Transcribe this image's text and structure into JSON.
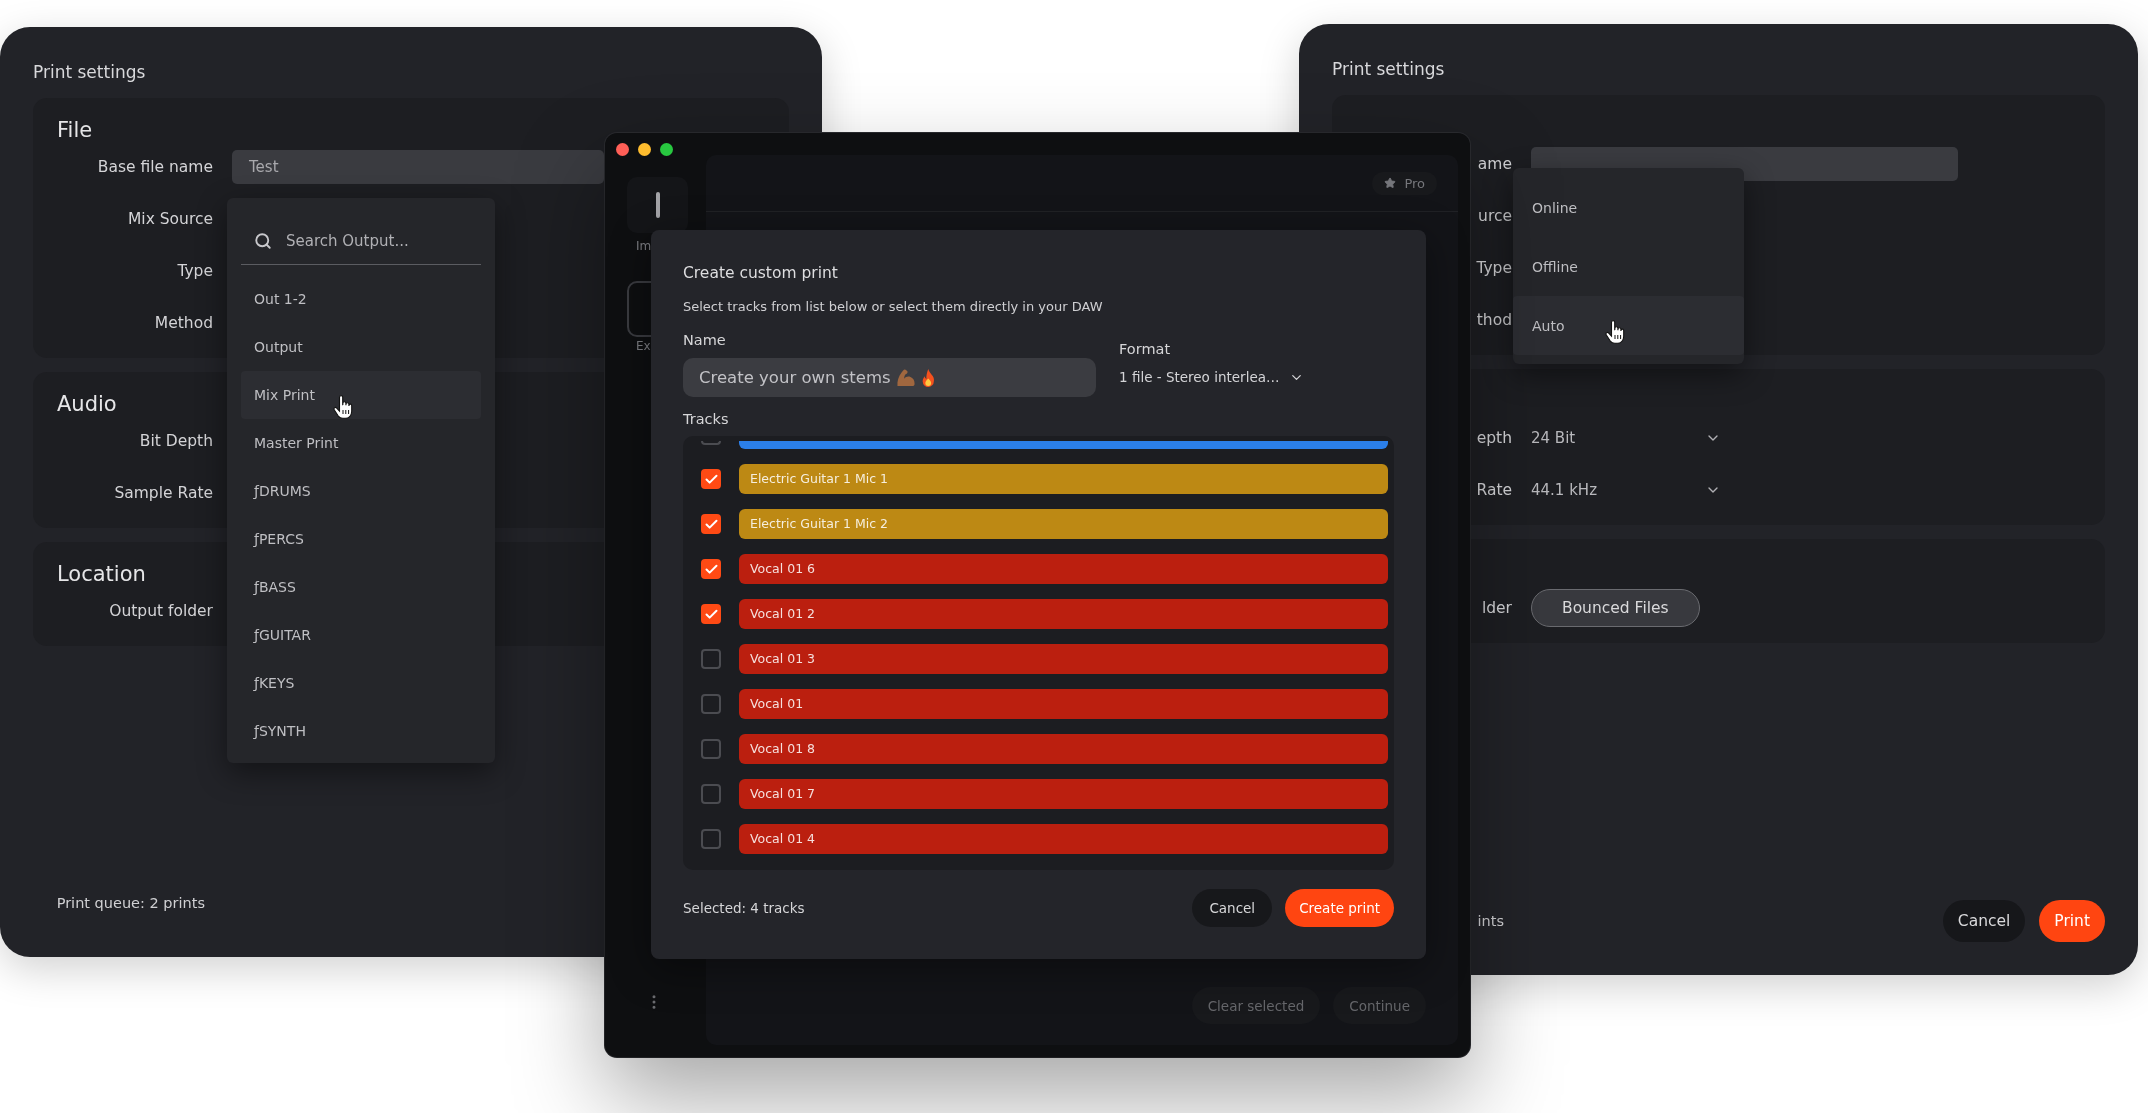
{
  "left_window": {
    "title": "Print settings",
    "sections": [
      {
        "heading": "File",
        "rows": [
          {
            "label": "Base file name",
            "control": {
              "kind": "input",
              "value": "Test"
            }
          },
          {
            "label": "Mix Source"
          },
          {
            "label": "Type"
          },
          {
            "label": "Method"
          }
        ]
      },
      {
        "heading": "Audio",
        "rows": [
          {
            "label": "Bit Depth"
          },
          {
            "label": "Sample Rate"
          }
        ]
      },
      {
        "heading": "Location",
        "rows": [
          {
            "label": "Output folder"
          }
        ]
      }
    ],
    "menu": {
      "search_placeholder": "Search Output...",
      "items": [
        {
          "label": "Out 1-2",
          "selected": false
        },
        {
          "label": "Output",
          "selected": false
        },
        {
          "label": "Mix Print",
          "selected": true
        },
        {
          "label": "Master Print",
          "selected": false
        },
        {
          "label": "ƒDRUMS",
          "selected": false
        },
        {
          "label": "ƒPERCS",
          "selected": false
        },
        {
          "label": "ƒBASS",
          "selected": false
        },
        {
          "label": "ƒGUITAR",
          "selected": false
        },
        {
          "label": "ƒKEYS",
          "selected": false
        },
        {
          "label": "ƒSYNTH",
          "selected": false
        }
      ]
    },
    "status": "Print queue: 2 prints"
  },
  "center_window": {
    "sidebar": {
      "items": [
        {
          "label": "Im",
          "selected": false
        },
        {
          "label": "Ex",
          "selected": true
        }
      ]
    },
    "badge": "Pro",
    "dialog": {
      "title": "Create custom print",
      "subtitle": "Select tracks from list below or select them directly in your DAW",
      "name_label": "Name",
      "name_value": "Create your own stems",
      "format_label": "Format",
      "format_value": "1 file - Stereo interlea…",
      "tracks_label": "Tracks",
      "tracks": [
        {
          "kind": "cut",
          "checked": false,
          "color": "#2b7fe9"
        },
        {
          "kind": "full",
          "name": "Electric Guitar 1 Mic 1",
          "checked": true,
          "color": "#bd8914"
        },
        {
          "kind": "full",
          "name": "Electric Guitar 1 Mic 2",
          "checked": true,
          "color": "#bd8914"
        },
        {
          "kind": "full",
          "name": "Vocal 01 6",
          "checked": true,
          "color": "#bb1f0f"
        },
        {
          "kind": "full",
          "name": "Vocal 01 2",
          "checked": true,
          "color": "#bb1f0f"
        },
        {
          "kind": "full",
          "name": "Vocal 01 3",
          "checked": false,
          "color": "#bb1f0f"
        },
        {
          "kind": "full",
          "name": "Vocal 01",
          "checked": false,
          "color": "#bb1f0f"
        },
        {
          "kind": "full",
          "name": "Vocal 01 8",
          "checked": false,
          "color": "#bb1f0f"
        },
        {
          "kind": "full",
          "name": "Vocal 01 7",
          "checked": false,
          "color": "#bb1f0f"
        },
        {
          "kind": "full",
          "name": "Vocal 01 4",
          "checked": false,
          "color": "#bb1f0f"
        }
      ],
      "selection": "Selected: 4 tracks",
      "buttons": [
        {
          "label": "Cancel",
          "kind": "secondary"
        },
        {
          "label": "Create print",
          "kind": "primary"
        }
      ]
    },
    "buttons": [
      {
        "label": "Clear selected",
        "disabled": true
      },
      {
        "label": "Continue",
        "disabled": true
      }
    ]
  },
  "right_window": {
    "title": "Print settings",
    "sections": [
      {
        "rows": [
          {
            "label": "ame",
            "control": {
              "kind": "input"
            }
          },
          {
            "label": "urce"
          },
          {
            "label": "Type"
          },
          {
            "label": "thod"
          }
        ]
      },
      {
        "rows": [
          {
            "label": "epth",
            "control": {
              "kind": "select",
              "value": "24 Bit"
            }
          },
          {
            "label": "Rate",
            "control": {
              "kind": "select",
              "value": "44.1 kHz"
            }
          }
        ]
      },
      {
        "rows": [
          {
            "label": "lder",
            "control": {
              "kind": "button",
              "value": "Bounced Files"
            }
          }
        ]
      }
    ],
    "menu": {
      "items": [
        {
          "label": "Online",
          "selected": false
        },
        {
          "label": "Offline",
          "selected": false
        },
        {
          "label": "Auto",
          "selected": true
        }
      ]
    },
    "status": "ints",
    "buttons": [
      {
        "label": "Cancel",
        "kind": "secondary"
      },
      {
        "label": "Print",
        "kind": "primary"
      }
    ]
  }
}
